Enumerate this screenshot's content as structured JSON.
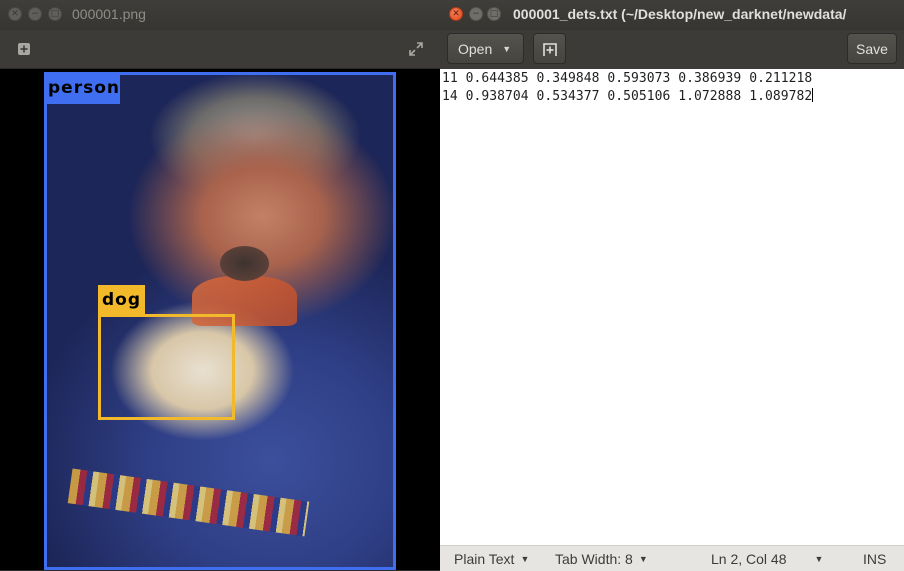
{
  "viewer": {
    "title": "000001.png",
    "detections": [
      {
        "label": "person",
        "color": "#3f6ff0"
      },
      {
        "label": "dog",
        "color": "#f2b92a"
      }
    ]
  },
  "editor": {
    "title": "000001_dets.txt (~/Desktop/new_darknet/newdata/",
    "open_label": "Open",
    "save_label": "Save",
    "lines": [
      "11 0.644385 0.349848 0.593073 0.386939 0.211218",
      "14 0.938704 0.534377 0.505106 1.072888 1.089782"
    ],
    "status": {
      "language": "Plain Text",
      "tab_width": "Tab Width: 8",
      "position": "Ln 2, Col 48",
      "mode": "INS"
    }
  },
  "icons": {
    "close": "close-icon",
    "minimize": "minimize-icon",
    "maximize": "maximize-icon",
    "add": "plus-icon",
    "fullscreen": "expand-icon",
    "new_tab": "new-tab-icon",
    "dropdown": "chevron-down-icon"
  }
}
